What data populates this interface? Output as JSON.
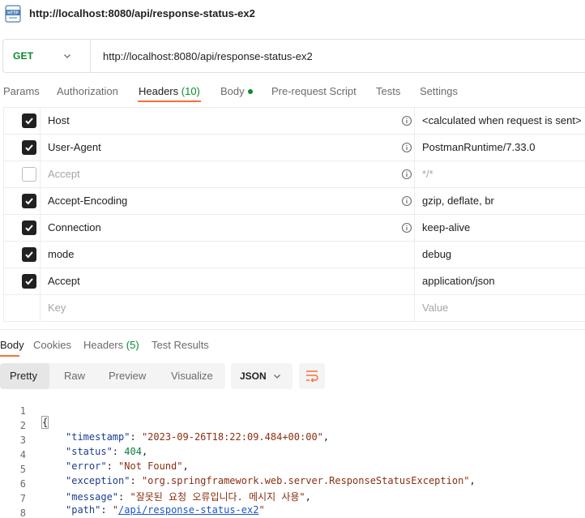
{
  "window": {
    "title": "http://localhost:8080/api/response-status-ex2",
    "icon": "http-file-icon"
  },
  "request": {
    "method": "GET",
    "url": "http://localhost:8080/api/response-status-ex2"
  },
  "request_tabs": [
    {
      "label": "Params"
    },
    {
      "label": "Authorization"
    },
    {
      "label": "Headers",
      "count": "(10)",
      "active": true
    },
    {
      "label": "Body",
      "has_dot": true
    },
    {
      "label": "Pre-request Script"
    },
    {
      "label": "Tests"
    },
    {
      "label": "Settings"
    }
  ],
  "headers": [
    {
      "checked": true,
      "key": "Host",
      "info": true,
      "value": "<calculated when request is sent>"
    },
    {
      "checked": true,
      "key": "User-Agent",
      "info": true,
      "value": "PostmanRuntime/7.33.0"
    },
    {
      "checked": false,
      "key": "Accept",
      "info": true,
      "value": "*/*"
    },
    {
      "checked": true,
      "key": "Accept-Encoding",
      "info": true,
      "value": "gzip, deflate, br"
    },
    {
      "checked": true,
      "key": "Connection",
      "info": true,
      "value": "keep-alive"
    },
    {
      "checked": true,
      "key": "mode",
      "info": false,
      "value": "debug"
    },
    {
      "checked": true,
      "key": "Accept",
      "info": false,
      "value": "application/json"
    }
  ],
  "headers_new_row": {
    "key_placeholder": "Key",
    "value_placeholder": "Value"
  },
  "response_tabs": [
    {
      "label": "Body",
      "active": true
    },
    {
      "label": "Cookies"
    },
    {
      "label": "Headers",
      "count": "(5)"
    },
    {
      "label": "Test Results"
    }
  ],
  "view_modes": [
    "Pretty",
    "Raw",
    "Preview",
    "Visualize"
  ],
  "active_view_mode": "Pretty",
  "format": "JSON",
  "response_lines": [
    {
      "num": "1",
      "text": "{"
    },
    {
      "num": "2",
      "key": "\"timestamp\"",
      "value": "\"2023-09-26T18:22:09.484+00:00\"",
      "kind": "string"
    },
    {
      "num": "3",
      "key": "\"status\"",
      "value": "404",
      "kind": "number"
    },
    {
      "num": "4",
      "key": "\"error\"",
      "value": "\"Not Found\"",
      "kind": "string"
    },
    {
      "num": "5",
      "key": "\"exception\"",
      "value": "\"org.springframework.web.server.ResponseStatusException\"",
      "kind": "string"
    },
    {
      "num": "6",
      "key": "\"message\"",
      "value": "\"잘못된 요청 오류입니다. 메시지 사용\"",
      "kind": "string"
    },
    {
      "num": "7",
      "key": "\"path\"",
      "value_prefix": "\"",
      "value_link": "/api/response-status-ex2",
      "value_suffix": "\"",
      "kind": "link",
      "last": true
    },
    {
      "num": "8",
      "text": "}"
    }
  ],
  "colors": {
    "accent": "#ff6c37",
    "method_green": "#0b8a2e",
    "json_key": "#1d3d8f",
    "json_string": "#8a2f10",
    "json_number": "#0b7d3e"
  }
}
